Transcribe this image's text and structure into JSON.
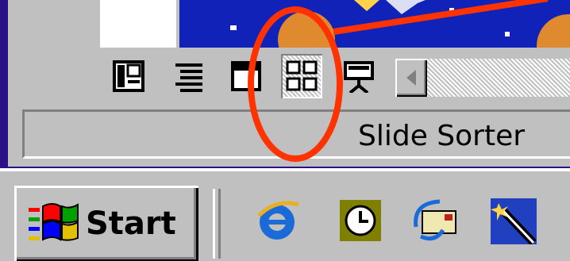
{
  "view_toolbar": {
    "buttons": [
      {
        "icon": "normal-view-icon"
      },
      {
        "icon": "outline-view-icon"
      },
      {
        "icon": "slide-view-icon"
      },
      {
        "icon": "slide-sorter-view-icon",
        "pressed": true
      },
      {
        "icon": "slide-show-icon"
      }
    ]
  },
  "status_bar": {
    "text": "Slide Sorter"
  },
  "taskbar": {
    "start_label": "Start",
    "quick_launch": [
      {
        "icon": "internet-explorer-icon"
      },
      {
        "icon": "clock-icon"
      },
      {
        "icon": "outlook-express-icon"
      },
      {
        "icon": "wand-icon"
      }
    ]
  },
  "annotation": {
    "color": "#ff3300"
  },
  "colors": {
    "desktop": "#2a0f86",
    "face": "#c0c0c0",
    "slide_background": "#1022b8"
  }
}
